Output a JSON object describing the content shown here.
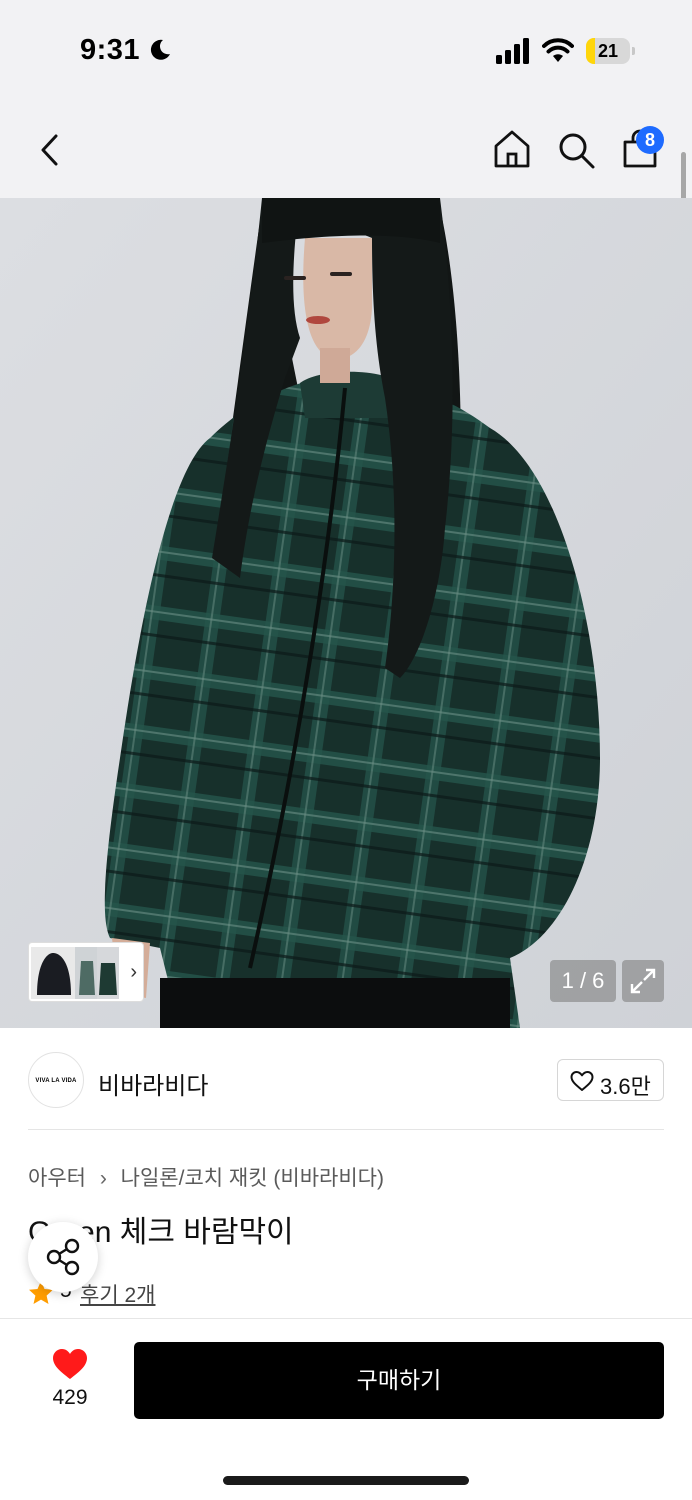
{
  "status_bar": {
    "time": "9:31",
    "battery": "21",
    "battery_level": 0.21
  },
  "header": {
    "cart_count": "8"
  },
  "gallery": {
    "counter": "1 / 6"
  },
  "brand": {
    "logo_text": "VIVA LA VIDA",
    "name": "비바라비다",
    "like_count": "3.6만"
  },
  "product": {
    "breadcrumb": [
      "아우터",
      "나일론/코치 재킷 (비바라비다)"
    ],
    "title": "Green 체크 바람막이",
    "rating": "5",
    "review_link": "후기 2개"
  },
  "bottom_bar": {
    "wish_count": "429",
    "buy_label": "구매하기"
  },
  "colors": {
    "accent_blue": "#1e6bff",
    "heart_red": "#ff1a1a",
    "star_orange": "#ff9d00",
    "jacket_green": "#1c3a33"
  }
}
